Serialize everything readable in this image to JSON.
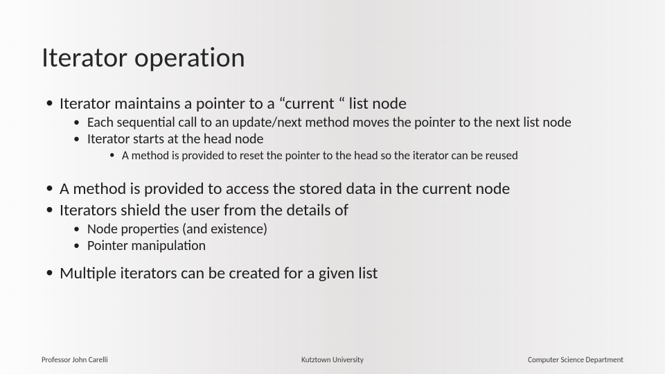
{
  "slide": {
    "title": "Iterator operation",
    "bullets": {
      "b1": "Iterator maintains a pointer to a “current “ list node",
      "b1a": "Each sequential call to an update/next  method moves the pointer to the next list node",
      "b1b": "Iterator starts at the head node",
      "b1b1": "A method is provided to reset the pointer to the head so the iterator can be reused",
      "b2": "A method is provided to access the stored data in the current node",
      "b3": "Iterators shield the user from the details of",
      "b3a": "Node properties (and existence)",
      "b3b": "Pointer manipulation",
      "b4": "Multiple iterators can be created for a given list"
    }
  },
  "footer": {
    "left": "Professor John Carelli",
    "center": "Kutztown University",
    "right": "Computer Science Department"
  }
}
